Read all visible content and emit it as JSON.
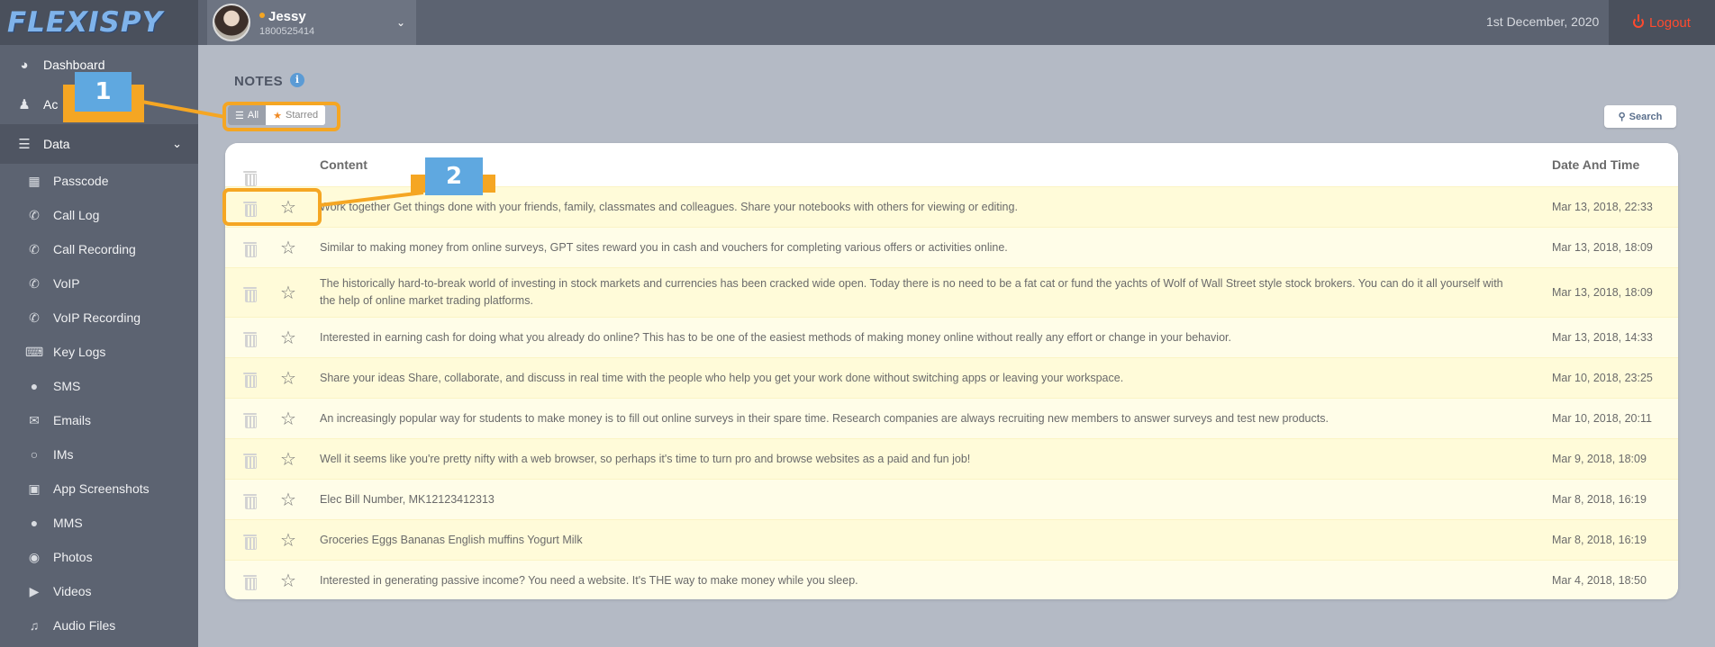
{
  "header": {
    "logo": "FLEXISPY",
    "user_name": "Jessy",
    "user_id": "1800525414",
    "date": "1st December, 2020",
    "logout_label": "Logout"
  },
  "sidebar": {
    "items": [
      {
        "label": "Dashboard",
        "icon": "dashboard-icon"
      },
      {
        "label": "Ac",
        "icon": "user-icon"
      },
      {
        "label": "Data",
        "icon": "database-icon"
      }
    ],
    "subitems": [
      {
        "label": "Passcode",
        "icon": "keypad-icon"
      },
      {
        "label": "Call Log",
        "icon": "phone-icon"
      },
      {
        "label": "Call Recording",
        "icon": "phone-recording-icon"
      },
      {
        "label": "VoIP",
        "icon": "voip-icon"
      },
      {
        "label": "VoIP Recording",
        "icon": "voip-recording-icon"
      },
      {
        "label": "Key Logs",
        "icon": "keyboard-icon"
      },
      {
        "label": "SMS",
        "icon": "chat-bubble-icon"
      },
      {
        "label": "Emails",
        "icon": "envelope-icon"
      },
      {
        "label": "IMs",
        "icon": "im-icon"
      },
      {
        "label": "App Screenshots",
        "icon": "screenshot-icon"
      },
      {
        "label": "MMS",
        "icon": "mms-icon"
      },
      {
        "label": "Photos",
        "icon": "camera-icon"
      },
      {
        "label": "Videos",
        "icon": "video-icon"
      },
      {
        "label": "Audio Files",
        "icon": "speaker-icon"
      }
    ]
  },
  "main": {
    "title": "NOTES",
    "filter_all": "All",
    "filter_starred": "Starred",
    "search_label": "Search",
    "columns": {
      "content": "Content",
      "date": "Date And Time"
    },
    "rows": [
      {
        "content": "Work together Get things done with your friends, family, classmates and colleagues. Share your notebooks with others for viewing or editing.",
        "date": "Mar 13, 2018, 22:33"
      },
      {
        "content": "Similar to making money from online surveys, GPT sites reward you in cash and vouchers for completing various offers or activities online.",
        "date": "Mar 13, 2018, 18:09"
      },
      {
        "content": "The historically hard-to-break world of investing in stock markets and currencies has been cracked wide open. Today there is no need to be a fat cat or fund the yachts of Wolf of Wall Street style stock brokers. You can do it all yourself with the help of online market trading platforms.",
        "date": "Mar 13, 2018, 18:09"
      },
      {
        "content": "Interested in earning cash for doing what you already do online? This has to be one of the easiest methods of making money online without really any effort or change in your behavior.",
        "date": "Mar 13, 2018, 14:33"
      },
      {
        "content": "Share your ideas Share, collaborate, and discuss in real time with the people who help you get your work done without switching apps or leaving your workspace.",
        "date": "Mar 10, 2018, 23:25"
      },
      {
        "content": "An increasingly popular way for students to make money is to fill out online surveys in their spare time. Research companies are always recruiting new members to answer surveys and test new products.",
        "date": "Mar 10, 2018, 20:11"
      },
      {
        "content": "Well it seems like you're pretty nifty with a web browser, so perhaps it's time to turn pro and browse websites as a paid and fun job!",
        "date": "Mar 9, 2018, 18:09"
      },
      {
        "content": "Elec Bill Number, MK12123412313",
        "date": "Mar 8, 2018, 16:19"
      },
      {
        "content": "Groceries Eggs Bananas English muffins Yogurt Milk",
        "date": "Mar 8, 2018, 16:19"
      },
      {
        "content": "Interested in generating passive income? You need a website. It's THE way to make money while you sleep.",
        "date": "Mar 4, 2018, 18:50"
      }
    ]
  },
  "annotations": {
    "label_1": "1",
    "label_2": "2"
  },
  "colors": {
    "accent": "#f5a623",
    "callout": "#5fa8e0",
    "logout": "#ff4a2e"
  }
}
